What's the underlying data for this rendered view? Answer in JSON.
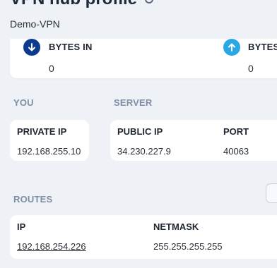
{
  "header": {
    "title": "VPN hub profile",
    "subtitle": "Demo-VPN",
    "refresh_icon": "refresh-icon"
  },
  "stats": {
    "bytes_in": {
      "label": "BYTES IN",
      "value": "0",
      "icon": "arrow-down-icon",
      "color": "#0b3a8f"
    },
    "bytes_out": {
      "label": "BYTES OUT",
      "value": "0",
      "icon": "arrow-up-icon",
      "color": "#2aa8e6"
    }
  },
  "you": {
    "section_label": "YOU",
    "private_ip_label": "PRIVATE IP",
    "private_ip_value": "192.168.255.10"
  },
  "server": {
    "section_label": "SERVER",
    "public_ip_label": "PUBLIC IP",
    "public_ip_value": "34.230.227.9",
    "port_label": "PORT",
    "port_value": "40063"
  },
  "routes": {
    "section_label": "ROUTES",
    "columns": [
      "IP",
      "NETMASK"
    ],
    "rows": [
      {
        "ip": "192.168.254.226",
        "netmask": "255.255.255.255"
      }
    ]
  },
  "colors": {
    "background": "#eef1f6",
    "card": "#ffffff",
    "section_label": "#7f8ea4",
    "accent_dark": "#0b3a8f",
    "accent_light": "#2aa8e6"
  }
}
